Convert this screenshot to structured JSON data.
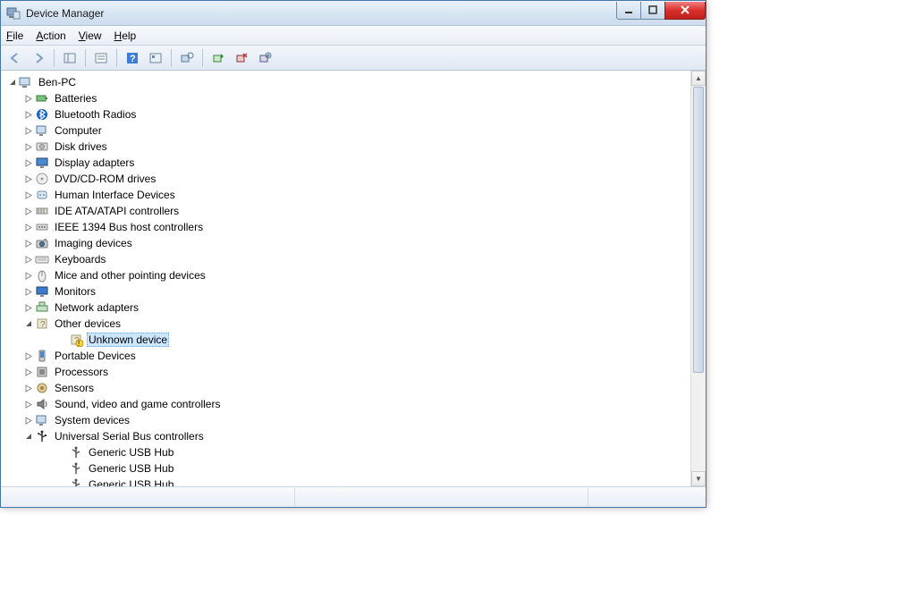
{
  "window": {
    "title": "Device Manager"
  },
  "menu": {
    "file": "File",
    "action": "Action",
    "view": "View",
    "help": "Help"
  },
  "tree": {
    "root": "Ben-PC",
    "nodes": [
      {
        "label": "Batteries",
        "icon": "battery"
      },
      {
        "label": "Bluetooth Radios",
        "icon": "bluetooth"
      },
      {
        "label": "Computer",
        "icon": "computer"
      },
      {
        "label": "Disk drives",
        "icon": "disk"
      },
      {
        "label": "Display adapters",
        "icon": "display"
      },
      {
        "label": "DVD/CD-ROM drives",
        "icon": "cdrom"
      },
      {
        "label": "Human Interface Devices",
        "icon": "hid"
      },
      {
        "label": "IDE ATA/ATAPI controllers",
        "icon": "ide"
      },
      {
        "label": "IEEE 1394 Bus host controllers",
        "icon": "1394"
      },
      {
        "label": "Imaging devices",
        "icon": "imaging"
      },
      {
        "label": "Keyboards",
        "icon": "keyboard"
      },
      {
        "label": "Mice and other pointing devices",
        "icon": "mouse"
      },
      {
        "label": "Monitors",
        "icon": "monitor"
      },
      {
        "label": "Network adapters",
        "icon": "network"
      }
    ],
    "other_devices": {
      "label": "Other devices",
      "child": "Unknown device"
    },
    "nodes2": [
      {
        "label": "Portable Devices",
        "icon": "portable"
      },
      {
        "label": "Processors",
        "icon": "cpu"
      },
      {
        "label": "Sensors",
        "icon": "sensor"
      },
      {
        "label": "Sound, video and game controllers",
        "icon": "sound"
      },
      {
        "label": "System devices",
        "icon": "system"
      }
    ],
    "usb": {
      "label": "Universal Serial Bus controllers",
      "children": [
        "Generic USB Hub",
        "Generic USB Hub",
        "Generic USB Hub"
      ]
    }
  }
}
